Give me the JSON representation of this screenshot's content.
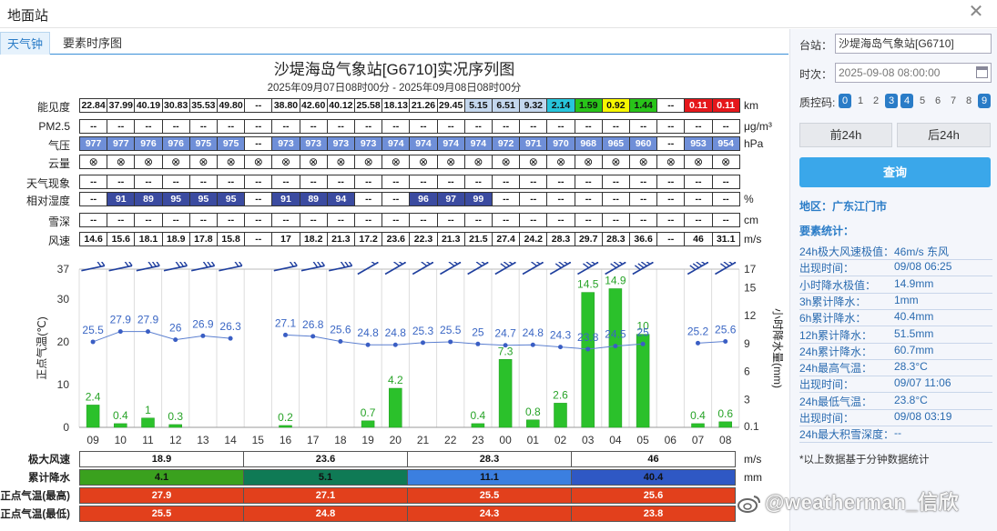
{
  "window": {
    "title": "地面站"
  },
  "tabs": [
    "天气钟",
    "要素时序图"
  ],
  "chart": {
    "title": "沙堤海岛气象站[G6710]实况序列图",
    "subtitle": "2025年09月07日08时00分 - 2025年09月08日08时00分"
  },
  "table": {
    "rows": [
      {
        "label": "能见度",
        "unit": "km",
        "cells": [
          "22.84",
          "37.99",
          "40.19",
          "30.83",
          "35.53",
          "49.80",
          "--",
          "38.80",
          "42.60",
          "40.12",
          "25.58",
          "18.13",
          "21.26",
          "29.45",
          "5.15",
          "6.51",
          "9.32",
          "2.14",
          "1.59",
          "0.92",
          "1.44",
          "--",
          "0.11",
          "0.11"
        ]
      },
      {
        "label": "PM2.5",
        "unit": "μg/m³",
        "cells": [
          "--",
          "--",
          "--",
          "--",
          "--",
          "--",
          "--",
          "--",
          "--",
          "--",
          "--",
          "--",
          "--",
          "--",
          "--",
          "--",
          "--",
          "--",
          "--",
          "--",
          "--",
          "--",
          "--",
          "--"
        ]
      },
      {
        "label": "气压",
        "unit": "hPa",
        "cells": [
          "977",
          "977",
          "976",
          "976",
          "975",
          "975",
          "--",
          "973",
          "973",
          "973",
          "973",
          "974",
          "974",
          "974",
          "974",
          "972",
          "971",
          "970",
          "968",
          "965",
          "960",
          "--",
          "953",
          "954"
        ]
      },
      {
        "label": "云量",
        "unit": "",
        "cells": [
          "⊗",
          "⊗",
          "⊗",
          "⊗",
          "⊗",
          "⊗",
          "⊗",
          "⊗",
          "⊗",
          "⊗",
          "⊗",
          "⊗",
          "⊗",
          "⊗",
          "⊗",
          "⊗",
          "⊗",
          "⊗",
          "⊗",
          "⊗",
          "⊗",
          "⊗",
          "⊗",
          "⊗"
        ]
      },
      {
        "label": "天气现象",
        "unit": "",
        "cells": [
          "--",
          "--",
          "--",
          "--",
          "--",
          "--",
          "--",
          "--",
          "--",
          "--",
          "--",
          "--",
          "--",
          "--",
          "--",
          "--",
          "--",
          "--",
          "--",
          "--",
          "--",
          "--",
          "--",
          "--"
        ]
      },
      {
        "label": "相对湿度",
        "unit": "%",
        "cells": [
          "--",
          "91",
          "89",
          "95",
          "95",
          "95",
          "--",
          "91",
          "89",
          "94",
          "--",
          "--",
          "96",
          "97",
          "99",
          "--",
          "--",
          "--",
          "--",
          "--",
          "--",
          "--",
          "--",
          "--"
        ]
      },
      {
        "label": "雪深",
        "unit": "cm",
        "cells": [
          "--",
          "--",
          "--",
          "--",
          "--",
          "--",
          "--",
          "--",
          "--",
          "--",
          "--",
          "--",
          "--",
          "--",
          "--",
          "--",
          "--",
          "--",
          "--",
          "--",
          "--",
          "--",
          "--",
          "--"
        ]
      },
      {
        "label": "风速",
        "unit": "m/s",
        "cells": [
          "14.6",
          "15.6",
          "18.1",
          "18.9",
          "17.8",
          "15.8",
          "--",
          "17",
          "18.2",
          "21.3",
          "17.2",
          "23.6",
          "22.3",
          "21.3",
          "21.5",
          "27.4",
          "24.2",
          "28.3",
          "29.7",
          "28.3",
          "36.6",
          "--",
          "46",
          "31.1"
        ]
      }
    ]
  },
  "chart_data": {
    "type": "bar",
    "categories": [
      "09",
      "10",
      "11",
      "12",
      "13",
      "14",
      "15",
      "16",
      "17",
      "18",
      "19",
      "20",
      "21",
      "22",
      "23",
      "00",
      "01",
      "02",
      "03",
      "04",
      "05",
      "06",
      "07",
      "08"
    ],
    "series": [
      {
        "values": [
          2.4,
          0.4,
          1,
          0.3,
          null,
          null,
          null,
          0.2,
          null,
          null,
          0.7,
          4.2,
          null,
          null,
          0.4,
          7.3,
          0.8,
          2.6,
          14.5,
          14.9,
          10,
          null,
          0.4,
          0.6
        ]
      },
      {
        "values": [
          25.5,
          27.9,
          27.9,
          26,
          26.9,
          26.3,
          null,
          27.1,
          26.8,
          25.6,
          24.8,
          24.8,
          25.3,
          25.5,
          25,
          24.7,
          24.8,
          24.3,
          23.8,
          24.5,
          25,
          null,
          25.2,
          25.6
        ]
      }
    ],
    "ylabel_left": "正点气温(℃)",
    "ylabel_right": "小时降水量(mm)",
    "left_axis_ticks": [
      "37",
      "30",
      "20",
      "10",
      "0"
    ],
    "right_axis_ticks": [
      "17",
      "15",
      "12",
      "9",
      "6",
      "3",
      "0.1"
    ],
    "left_ylim": [
      0,
      37
    ],
    "right_ylim": [
      0,
      17
    ]
  },
  "bottom": {
    "rows": [
      {
        "label": "极大风速",
        "unit": "m/s",
        "values": [
          "18.9",
          "23.6",
          "28.3",
          "46"
        ]
      },
      {
        "label": "累计降水",
        "unit": "mm",
        "values": [
          "4.1",
          "5.1",
          "11.1",
          "40.4"
        ]
      },
      {
        "label": "正点气温(最高)",
        "unit": "",
        "values": [
          "27.9",
          "27.1",
          "25.5",
          "25.6"
        ]
      },
      {
        "label": "正点气温(最低)",
        "unit": "",
        "values": [
          "25.5",
          "24.8",
          "24.3",
          "23.8"
        ]
      }
    ],
    "colors": {
      "rain": [
        "#3aa11e",
        "#0f7a55",
        "#3b7fe0",
        "#2f58c4"
      ],
      "temp": "#e2401c"
    }
  },
  "sidebar": {
    "station_label": "台站：",
    "station_value": "沙堤海岛气象站[G6710]",
    "time_label": "时次：",
    "time_value": "2025-09-08 08:00:00",
    "qc_label": "质控码:",
    "qc_codes": [
      "0",
      "1",
      "2",
      "3",
      "4",
      "5",
      "6",
      "7",
      "8",
      "9"
    ],
    "qc_active": [
      true,
      false,
      false,
      true,
      true,
      false,
      false,
      false,
      false,
      true
    ],
    "prev_button": "前24h",
    "next_button": "后24h",
    "query_button": "查询",
    "region": "地区：广东江门市",
    "stats_title": "要素统计：",
    "stats": [
      {
        "k": "24h极大风速极值：",
        "v": "46m/s 东风"
      },
      {
        "k": "出现时间：",
        "v": "09/08 06:25"
      },
      {
        "k": "小时降水极值：",
        "v": "14.9mm"
      },
      {
        "k": "3h累计降水：",
        "v": "1mm"
      },
      {
        "k": "6h累计降水：",
        "v": "40.4mm"
      },
      {
        "k": "12h累计降水：",
        "v": "51.5mm"
      },
      {
        "k": "24h累计降水：",
        "v": "60.7mm"
      },
      {
        "k": "24h最高气温：",
        "v": "28.3°C"
      },
      {
        "k": "出现时间：",
        "v": "09/07 11:06"
      },
      {
        "k": "24h最低气温：",
        "v": "23.8°C"
      },
      {
        "k": "出现时间：",
        "v": "09/08 03:19"
      },
      {
        "k": "24h最大积雪深度：",
        "v": "--"
      }
    ],
    "note": "*以上数据基于分钟数据统计"
  },
  "watermark": "@weatherman_信欣"
}
